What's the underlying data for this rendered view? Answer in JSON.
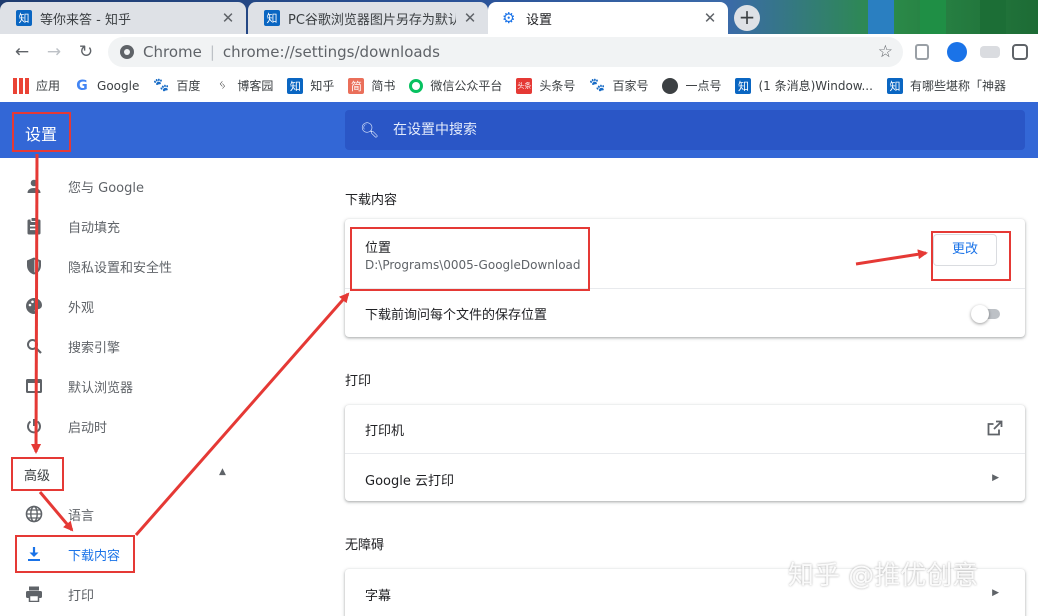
{
  "tabs": [
    {
      "title": "等你来答 - 知乎",
      "favicon": "知"
    },
    {
      "title": "PC谷歌浏览器图片另存为默认路径",
      "favicon": "知"
    },
    {
      "title": "设置",
      "favicon": "gear-icon"
    }
  ],
  "toolbar": {
    "site_label": "Chrome",
    "url": "chrome://settings/downloads"
  },
  "bookmarks": [
    {
      "label": "应用",
      "icon": "apps-grid-icon"
    },
    {
      "label": "Google",
      "icon": "google-icon"
    },
    {
      "label": "百度",
      "icon": "baidu-paw-icon"
    },
    {
      "label": "博客园",
      "icon": "cnblogs-icon"
    },
    {
      "label": "知乎",
      "icon": "zhihu-icon"
    },
    {
      "label": "简书",
      "icon": "jianshu-icon"
    },
    {
      "label": "微信公众平台",
      "icon": "wechat-icon"
    },
    {
      "label": "头条号",
      "icon": "toutiao-icon"
    },
    {
      "label": "百家号",
      "icon": "baidu-paw-icon"
    },
    {
      "label": "一点号",
      "icon": "yidian-icon"
    },
    {
      "label": "(1 条消息)Window...",
      "icon": "zhihu-icon"
    },
    {
      "label": "有哪些堪称「神器",
      "icon": "zhihu-icon"
    }
  ],
  "header": {
    "title": "设置",
    "search_placeholder": "在设置中搜索"
  },
  "sidebar": {
    "items": [
      {
        "label": "您与 Google",
        "icon": "person-icon"
      },
      {
        "label": "自动填充",
        "icon": "clipboard-icon"
      },
      {
        "label": "隐私设置和安全性",
        "icon": "shield-icon"
      },
      {
        "label": "外观",
        "icon": "palette-icon"
      },
      {
        "label": "搜索引擎",
        "icon": "search-icon"
      },
      {
        "label": "默认浏览器",
        "icon": "browser-icon"
      },
      {
        "label": "启动时",
        "icon": "power-icon"
      }
    ],
    "advanced_label": "高级",
    "advanced_items": [
      {
        "label": "语言",
        "icon": "globe-icon"
      },
      {
        "label": "下载内容",
        "icon": "download-icon",
        "active": true
      },
      {
        "label": "打印",
        "icon": "printer-icon"
      }
    ]
  },
  "downloads": {
    "section_title": "下载内容",
    "location_label": "位置",
    "location_value": "D:\\Programs\\0005-GoogleDownload",
    "change_button": "更改",
    "ask_label": "下载前询问每个文件的保存位置",
    "ask_enabled": false
  },
  "print": {
    "section_title": "打印",
    "printers_label": "打印机",
    "cloud_print_label": "Google 云打印"
  },
  "accessibility": {
    "section_title": "无障碍",
    "captions_label": "字幕"
  },
  "watermark": "知乎 @推优创意",
  "colors": {
    "header_blue": "#3367d6",
    "search_blue": "#2a56c6",
    "accent": "#1a73e8",
    "annotation_red": "#e53935"
  }
}
